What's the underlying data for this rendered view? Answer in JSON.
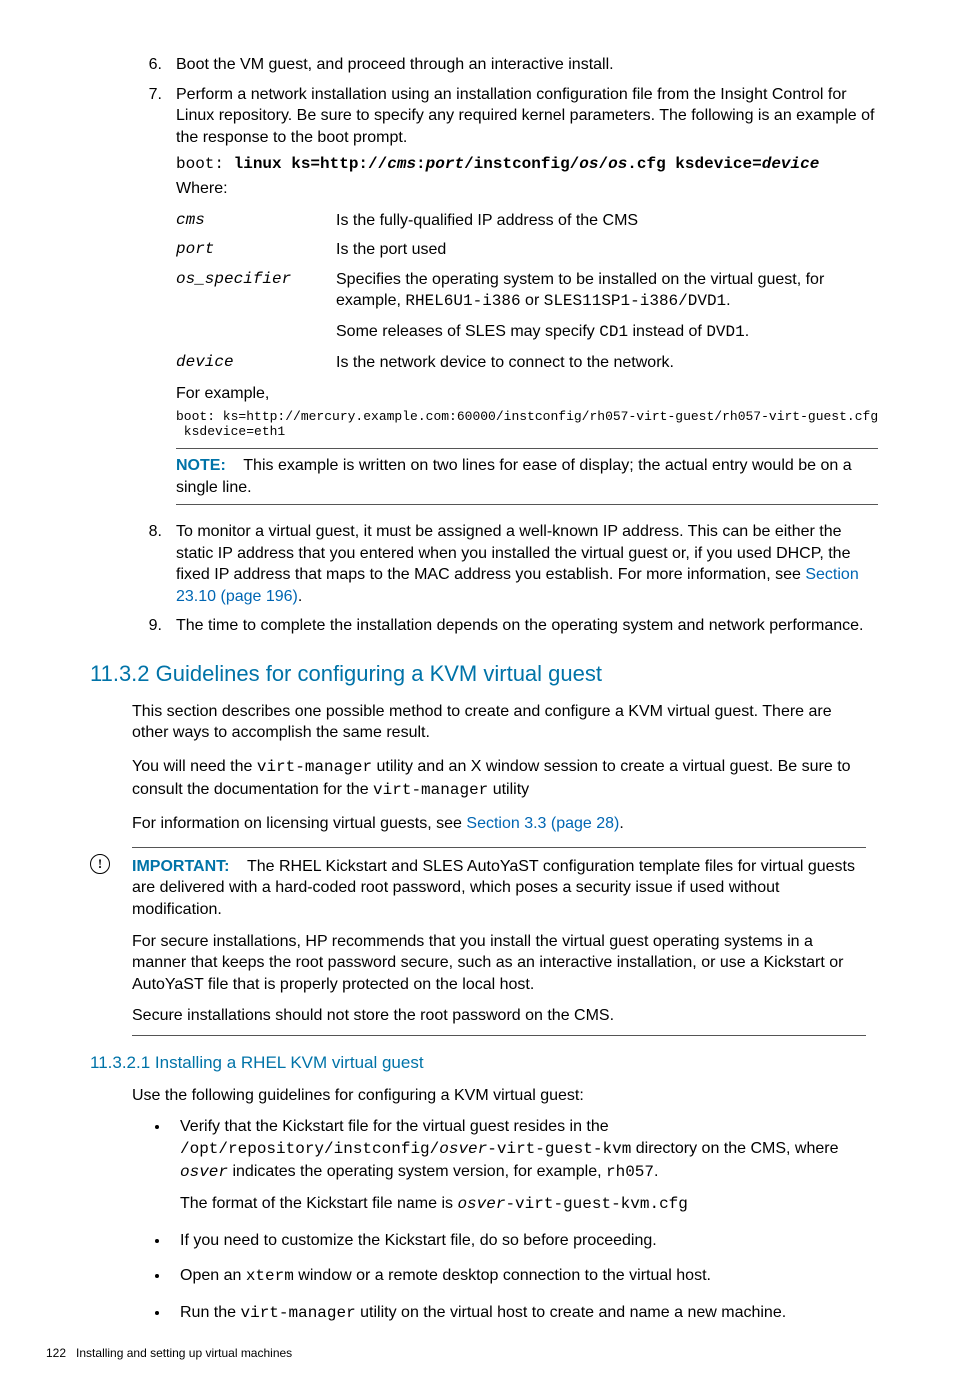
{
  "steps": {
    "s6": {
      "num": "6.",
      "text": "Boot the VM guest, and proceed through an interactive install."
    },
    "s7": {
      "num": "7.",
      "intro": "Perform a network installation using an installation configuration file from the Insight Control for Linux repository. Be sure to specify any required kernel parameters. The following is an example of the response to the boot prompt.",
      "cmd_prefix": "boot: ",
      "cmd_bold1": "linux ks=http://",
      "cmd_it1": "cms",
      "cmd_bold2": ":",
      "cmd_it2": "port",
      "cmd_bold3": "/instconfig/",
      "cmd_it3": "os",
      "cmd_bold4": "/",
      "cmd_it4": "os",
      "cmd_bold5": ".cfg ksdevice=",
      "cmd_it5": "device",
      "where": "Where:",
      "def": {
        "cms_t": "cms",
        "cms_d": "Is the fully-qualified IP address of the CMS",
        "port_t": "port",
        "port_d": "Is the port used",
        "os_t": "os_specifier",
        "os_d1a": "Specifies the operating system to be installed on the virtual guest, for example, ",
        "os_d1b": "RHEL6U1-i386",
        "os_d1c": " or ",
        "os_d1d": "SLES11SP1-i386/DVD1",
        "os_d1e": ".",
        "os_d2a": "Some releases of SLES may specify ",
        "os_d2b": "CD1",
        "os_d2c": " instead of ",
        "os_d2d": "DVD1",
        "os_d2e": ".",
        "dev_t": "device",
        "dev_d": "Is the network device to connect to the network."
      },
      "for_example": "For example,",
      "example_code": "boot: ks=http://mercury.example.com:60000/instconfig/rh057-virt-guest/rh057-virt-guest.cfg\n ksdevice=eth1",
      "note_label": "NOTE:",
      "note_text": " This example is written on two lines for ease of display; the actual entry would be on a single line."
    },
    "s8": {
      "num": "8.",
      "t1": "To monitor a virtual guest, it must be assigned a well-known IP address. This can be either the static IP address that you entered when you installed the virtual guest or, if you used DHCP, the fixed IP address that maps to the MAC address you establish. For more information, see ",
      "link": "Section 23.10 (page 196)",
      "t2": "."
    },
    "s9": {
      "num": "9.",
      "text": "The time to complete the installation depends on the operating system and network performance."
    }
  },
  "sec1132": {
    "title": "11.3.2 Guidelines for configuring a KVM virtual guest",
    "p1": "This section describes one possible method to create and configure a KVM virtual guest. There are other ways to accomplish the same result.",
    "p2a": "You will need the ",
    "p2b": "virt-manager",
    "p2c": " utility and an X window session to create a virtual guest. Be sure to consult the documentation for the ",
    "p2d": "virt-manager",
    "p2e": " utility",
    "p3a": "For information on licensing virtual guests, see ",
    "p3b": "Section 3.3 (page 28)",
    "p3c": ".",
    "imp_label": "IMPORTANT:",
    "imp_p1": " The RHEL Kickstart and SLES AutoYaST configuration template files for virtual guests are delivered with a hard-coded root password, which poses a security issue if used without modification.",
    "imp_p2": "For secure installations, HP recommends that you install the virtual guest operating systems in a manner that keeps the root password secure, such as an interactive installation, or use a Kickstart or AutoYaST file that is properly protected on the local host.",
    "imp_p3": "Secure installations should not store the root password on the CMS."
  },
  "sec11321": {
    "title": "11.3.2.1 Installing a RHEL KVM virtual guest",
    "intro": "Use the following guidelines for configuring a KVM virtual guest:",
    "b1": {
      "l1a": "Verify that the Kickstart file for the virtual guest resides in the ",
      "l1b": "/opt/repository/instconfig/",
      "l1c": "osver",
      "l1d": "-virt-guest-kvm",
      "l1e": " directory on the CMS, where ",
      "l1f": "osver",
      "l1g": " indicates the operating system version, for example, ",
      "l1h": "rh057",
      "l1i": ".",
      "l2a": "The format of the Kickstart file name is ",
      "l2b": "osver",
      "l2c": "-virt-guest-kvm.cfg"
    },
    "b2": "If you need to customize the Kickstart file, do so before proceeding.",
    "b3a": "Open an ",
    "b3b": "xterm",
    "b3c": " window or a remote desktop connection to the virtual host.",
    "b4a": "Run the ",
    "b4b": "virt-manager",
    "b4c": " utility on the virtual host to create and name a new machine."
  },
  "footer": {
    "page": "122",
    "title": "Installing and setting up virtual machines"
  }
}
